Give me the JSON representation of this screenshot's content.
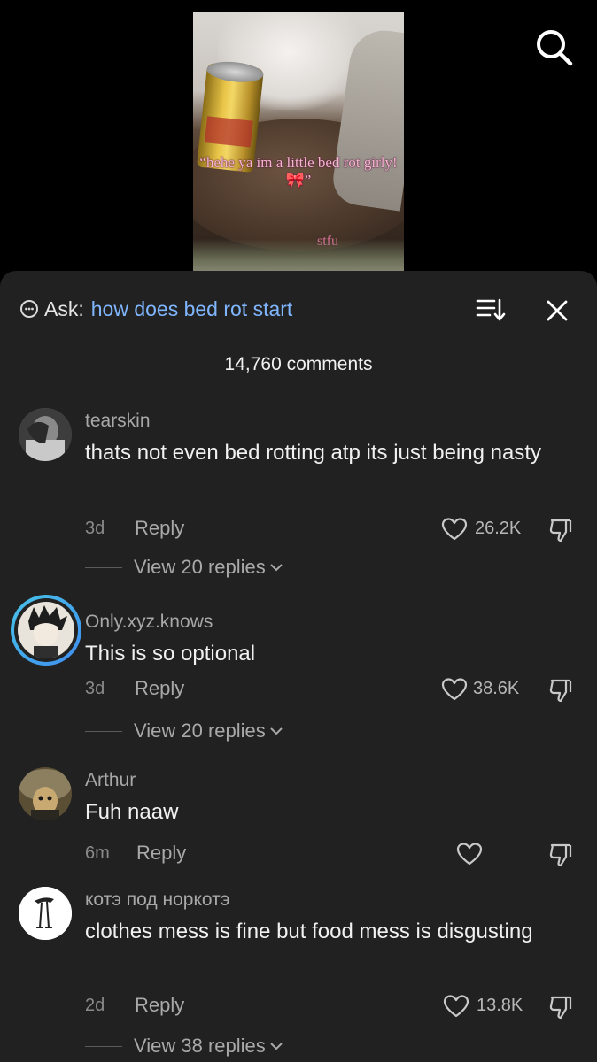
{
  "video": {
    "overlay_text": "“hehe ya im a little bed rot girly!🎀”",
    "overlay_sub": "stfu"
  },
  "search": {
    "icon": "search-icon"
  },
  "ask": {
    "label": "Ask:",
    "query": "how does bed rot start"
  },
  "comment_count": "14,760 comments",
  "comments": [
    {
      "username": "tearskin",
      "text": "thats not even bed rotting atp its just being nasty",
      "time": "3d",
      "reply_label": "Reply",
      "likes": "26.2K",
      "view_replies": "View 20 replies"
    },
    {
      "username": "Only.xyz.knows",
      "text": "This is so optional",
      "time": "3d",
      "reply_label": "Reply",
      "likes": "38.6K",
      "view_replies": "View 20 replies"
    },
    {
      "username": "Arthur",
      "text": "Fuh naaw",
      "time": "6m",
      "reply_label": "Reply",
      "likes": ""
    },
    {
      "username": "котэ под норкотэ",
      "text": "clothes mess is fine but food mess is disgusting",
      "time": "2d",
      "reply_label": "Reply",
      "likes": "13.8K",
      "view_replies": "View 38 replies"
    }
  ],
  "colors": {
    "sheet_bg": "#212121",
    "ask_query": "#7fb6ff",
    "story_ring_start": "#47c4e8",
    "story_ring_end": "#3f8df0"
  }
}
